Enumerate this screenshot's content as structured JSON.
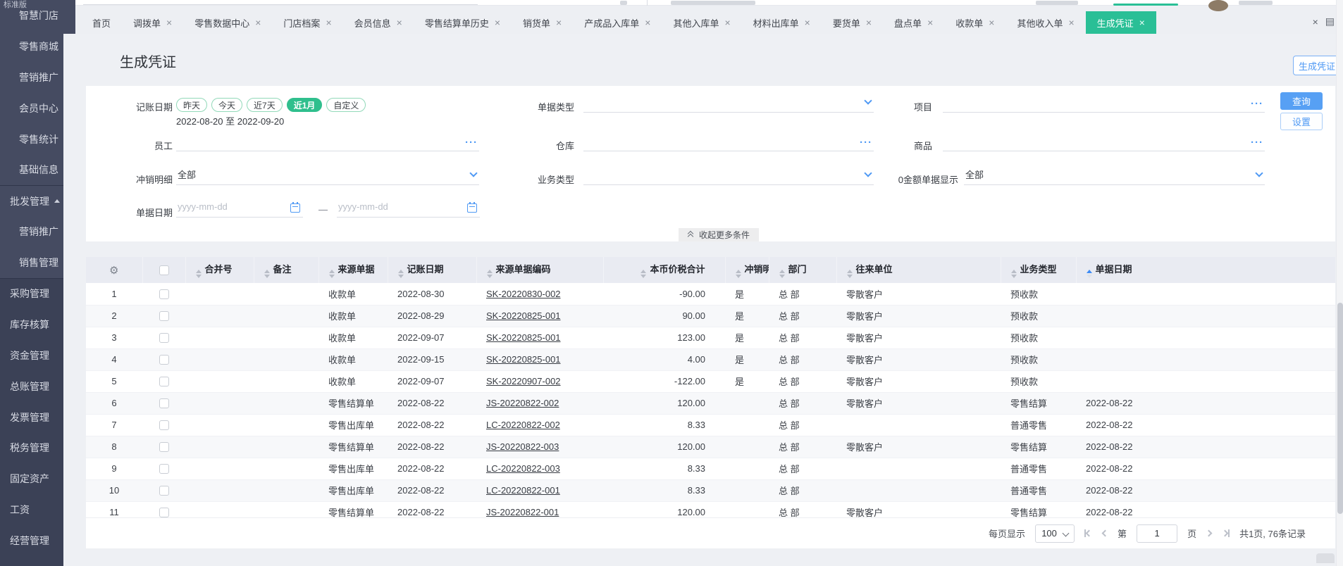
{
  "colors": {
    "accent_blue": "#4f99f4",
    "active_tab_teal": "#2abf96",
    "active_pill_green": "#2fbf8d",
    "sidebar_bg": "#3b4156",
    "table_header_bg": "#e9ebf2"
  },
  "icons": {
    "close": "×",
    "gear": "⚙",
    "ellipsis": "···",
    "panel": "▤"
  },
  "sidebar": {
    "edition": "标准版",
    "items": [
      {
        "label": "智慧门店",
        "sub": true,
        "lit": true
      },
      {
        "label": "零售商城",
        "sub": true,
        "lit": true
      },
      {
        "label": "营销推广",
        "sub": true,
        "lit": true
      },
      {
        "label": "会员中心",
        "sub": true,
        "lit": true
      },
      {
        "label": "零售统计",
        "sub": true,
        "lit": true
      },
      {
        "label": "基础信息",
        "sub": true,
        "lit": true
      },
      {
        "label": "批发管理",
        "expanded": true,
        "lit": true,
        "divider": true
      },
      {
        "label": "营销推广",
        "sub": true,
        "lit": true
      },
      {
        "label": "销售管理",
        "sub": true,
        "lit": true
      },
      {
        "label": "采购管理",
        "divider": true
      },
      {
        "label": "库存核算"
      },
      {
        "label": "资金管理"
      },
      {
        "label": "总账管理"
      },
      {
        "label": "发票管理"
      },
      {
        "label": "税务管理"
      },
      {
        "label": "固定资产"
      },
      {
        "label": "工资"
      },
      {
        "label": "经营管理"
      }
    ]
  },
  "tabs": {
    "items": [
      {
        "label": "首页",
        "closable": false
      },
      {
        "label": "调拨单",
        "closable": true
      },
      {
        "label": "零售数据中心",
        "closable": true
      },
      {
        "label": "门店档案",
        "closable": true
      },
      {
        "label": "会员信息",
        "closable": true
      },
      {
        "label": "零售结算单历史",
        "closable": true
      },
      {
        "label": "销货单",
        "closable": true
      },
      {
        "label": "产成品入库单",
        "closable": true
      },
      {
        "label": "其他入库单",
        "closable": true
      },
      {
        "label": "材料出库单",
        "closable": true
      },
      {
        "label": "要货单",
        "closable": true
      },
      {
        "label": "盘点单",
        "closable": true
      },
      {
        "label": "收款单",
        "closable": true
      },
      {
        "label": "其他收入单",
        "closable": true
      },
      {
        "label": "生成凭证",
        "closable": true,
        "active": true
      }
    ]
  },
  "page": {
    "title": "生成凭证",
    "generate_button": "生成凭证"
  },
  "filters": {
    "booking_date": {
      "label": "记账日期",
      "options": [
        {
          "label": "昨天"
        },
        {
          "label": "今天"
        },
        {
          "label": "近7天"
        },
        {
          "label": "近1月",
          "active": true
        },
        {
          "label": "自定义"
        }
      ],
      "range": "2022-08-20 至 2022-09-20"
    },
    "doc_type": {
      "label": "单据类型",
      "value": ""
    },
    "project": {
      "label": "项目",
      "value": ""
    },
    "employee": {
      "label": "员工",
      "value": ""
    },
    "warehouse": {
      "label": "仓库",
      "value": ""
    },
    "goods": {
      "label": "商品",
      "value": ""
    },
    "writeoff": {
      "label": "冲销明细",
      "value": "全部"
    },
    "biz_type": {
      "label": "业务类型",
      "value": ""
    },
    "zero_amount": {
      "label": "0金额单据显示",
      "value": "全部"
    },
    "doc_date": {
      "label": "单据日期",
      "start_placeholder": "yyyy-mm-dd",
      "end_placeholder": "yyyy-mm-dd",
      "separator": "—"
    },
    "query_button": "查询",
    "settings_button": "设置",
    "collapse_button": "收起更多条件"
  },
  "table": {
    "columns": [
      {
        "label": "合并号"
      },
      {
        "label": "备注"
      },
      {
        "label": "来源单据"
      },
      {
        "label": "记账日期"
      },
      {
        "label": "来源单据编码"
      },
      {
        "label": "本币价税合计",
        "align_right": true
      },
      {
        "label": "冲销明细"
      },
      {
        "label": "部门"
      },
      {
        "label": "往来单位"
      },
      {
        "label": "业务类型"
      },
      {
        "label": "单据日期",
        "sorted": true
      }
    ],
    "rows": [
      {
        "seq": "1",
        "merge": "",
        "note": "",
        "source": "收款单",
        "book_date": "2022-08-30",
        "code": "SK-20220830-002",
        "amount": "-90.00",
        "writeoff": "是",
        "dept": "总 部",
        "partner": "零散客户",
        "biz": "预收款",
        "doc_date": ""
      },
      {
        "seq": "2",
        "merge": "",
        "note": "",
        "source": "收款单",
        "book_date": "2022-08-29",
        "code": "SK-20220825-001",
        "amount": "90.00",
        "writeoff": "是",
        "dept": "总 部",
        "partner": "零散客户",
        "biz": "预收款",
        "doc_date": ""
      },
      {
        "seq": "3",
        "merge": "",
        "note": "",
        "source": "收款单",
        "book_date": "2022-09-07",
        "code": "SK-20220825-001",
        "amount": "123.00",
        "writeoff": "是",
        "dept": "总 部",
        "partner": "零散客户",
        "biz": "预收款",
        "doc_date": ""
      },
      {
        "seq": "4",
        "merge": "",
        "note": "",
        "source": "收款单",
        "book_date": "2022-09-15",
        "code": "SK-20220825-001",
        "amount": "4.00",
        "writeoff": "是",
        "dept": "总 部",
        "partner": "零散客户",
        "biz": "预收款",
        "doc_date": ""
      },
      {
        "seq": "5",
        "merge": "",
        "note": "",
        "source": "收款单",
        "book_date": "2022-09-07",
        "code": "SK-20220907-002",
        "amount": "-122.00",
        "writeoff": "是",
        "dept": "总 部",
        "partner": "零散客户",
        "biz": "预收款",
        "doc_date": ""
      },
      {
        "seq": "6",
        "merge": "",
        "note": "",
        "source": "零售结算单",
        "book_date": "2022-08-22",
        "code": "JS-20220822-002",
        "amount": "120.00",
        "writeoff": "",
        "dept": "总 部",
        "partner": "零散客户",
        "biz": "零售结算",
        "doc_date": "2022-08-22"
      },
      {
        "seq": "7",
        "merge": "",
        "note": "",
        "source": "零售出库单",
        "book_date": "2022-08-22",
        "code": "LC-20220822-002",
        "amount": "8.33",
        "writeoff": "",
        "dept": "总 部",
        "partner": "",
        "biz": "普通零售",
        "doc_date": "2022-08-22"
      },
      {
        "seq": "8",
        "merge": "",
        "note": "",
        "source": "零售结算单",
        "book_date": "2022-08-22",
        "code": "JS-20220822-003",
        "amount": "120.00",
        "writeoff": "",
        "dept": "总 部",
        "partner": "零散客户",
        "biz": "零售结算",
        "doc_date": "2022-08-22"
      },
      {
        "seq": "9",
        "merge": "",
        "note": "",
        "source": "零售出库单",
        "book_date": "2022-08-22",
        "code": "LC-20220822-003",
        "amount": "8.33",
        "writeoff": "",
        "dept": "总 部",
        "partner": "",
        "biz": "普通零售",
        "doc_date": "2022-08-22"
      },
      {
        "seq": "10",
        "merge": "",
        "note": "",
        "source": "零售出库单",
        "book_date": "2022-08-22",
        "code": "LC-20220822-001",
        "amount": "8.33",
        "writeoff": "",
        "dept": "总 部",
        "partner": "",
        "biz": "普通零售",
        "doc_date": "2022-08-22"
      },
      {
        "seq": "11",
        "merge": "",
        "note": "",
        "source": "零售结算单",
        "book_date": "2022-08-22",
        "code": "JS-20220822-001",
        "amount": "120.00",
        "writeoff": "",
        "dept": "总 部",
        "partner": "零散客户",
        "biz": "零售结算",
        "doc_date": "2022-08-22"
      }
    ]
  },
  "pagination": {
    "page_size_label": "每页显示",
    "page_size": "100",
    "page_prefix": "第",
    "page_value": "1",
    "page_suffix": "页",
    "total_text": "共1页, 76条记录"
  }
}
